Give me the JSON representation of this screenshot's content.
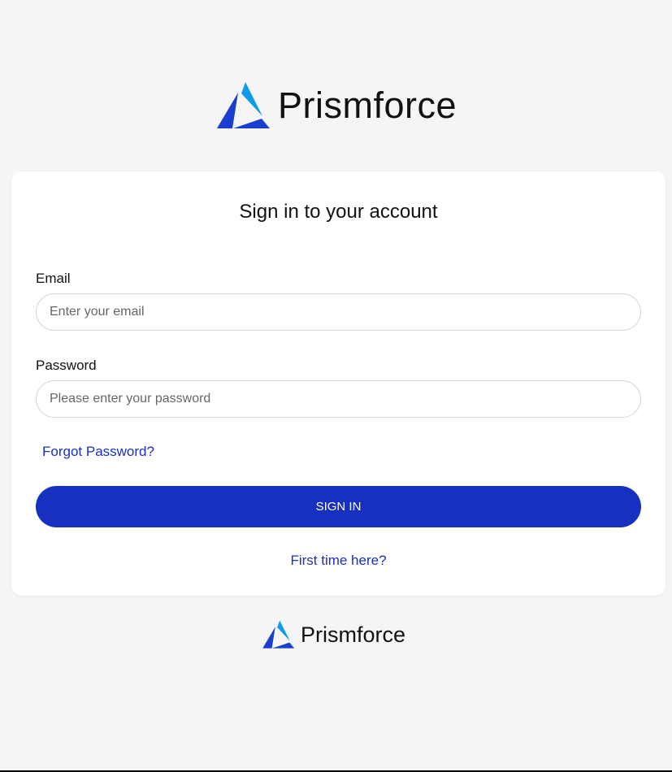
{
  "brand": {
    "name": "Prismforce",
    "colors": {
      "dark_blue": "#1a3fd0",
      "light_blue": "#0e9be8"
    }
  },
  "form": {
    "title": "Sign in to your account",
    "email_label": "Email",
    "email_placeholder": "Enter your email",
    "password_label": "Password",
    "password_placeholder": "Please enter your password",
    "forgot_password": "Forgot Password?",
    "sign_in": "SIGN IN",
    "first_time": "First time here?",
    "accent": "#1730bf"
  },
  "footer": {
    "brand": "Prismforce"
  }
}
